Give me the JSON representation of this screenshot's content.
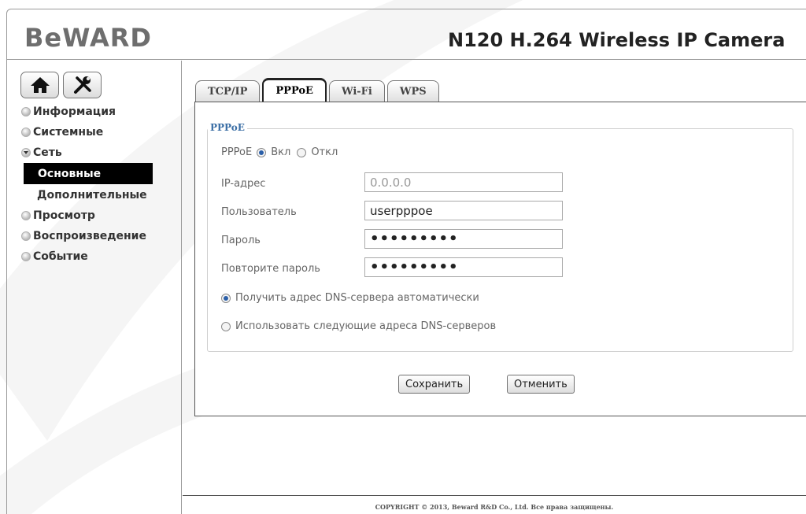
{
  "header": {
    "logo": "BeWARD",
    "title": "N120 H.264 Wireless IP Camera"
  },
  "sidebar": {
    "top_buttons": [
      {
        "icon": "home-icon"
      },
      {
        "icon": "tools-icon"
      }
    ],
    "items": [
      {
        "label": "Информация"
      },
      {
        "label": "Системные"
      },
      {
        "label": "Сеть",
        "expanded": true
      },
      {
        "label": "Просмотр"
      },
      {
        "label": "Воспроизведение"
      },
      {
        "label": "Событие"
      }
    ],
    "subitems": [
      {
        "label": "Основные",
        "active": true
      },
      {
        "label": "Дополнительные"
      }
    ]
  },
  "tabs": [
    {
      "label": "TCP/IP"
    },
    {
      "label": "PPPoE",
      "active": true
    },
    {
      "label": "Wi-Fi"
    },
    {
      "label": "WPS"
    }
  ],
  "form": {
    "legend": "PPPoE",
    "pppoe_label": "PPPoE",
    "on_label": "Вкл",
    "off_label": "Откл",
    "pppoe_state": "on",
    "ip_label": "IP-адрес",
    "ip_value": "0.0.0.0",
    "user_label": "Пользователь",
    "user_value": "userpppoe",
    "password_label": "Пароль",
    "password_value": "•••••••••",
    "repeat_label": "Повторите пароль",
    "repeat_value": "•••••••••",
    "dns_auto_label": "Получить адрес DNS-сервера автоматически",
    "dns_manual_label": "Использовать следующие адреса DNS-серверов",
    "dns_mode": "auto"
  },
  "buttons": {
    "save": "Сохранить",
    "cancel": "Отменить"
  },
  "footer": "COPYRIGHT © 2013, Beward R&D Co., Ltd. Все права защищены.",
  "colors": {
    "accent": "#3a6ea5",
    "active_menu_bg": "#000000"
  }
}
